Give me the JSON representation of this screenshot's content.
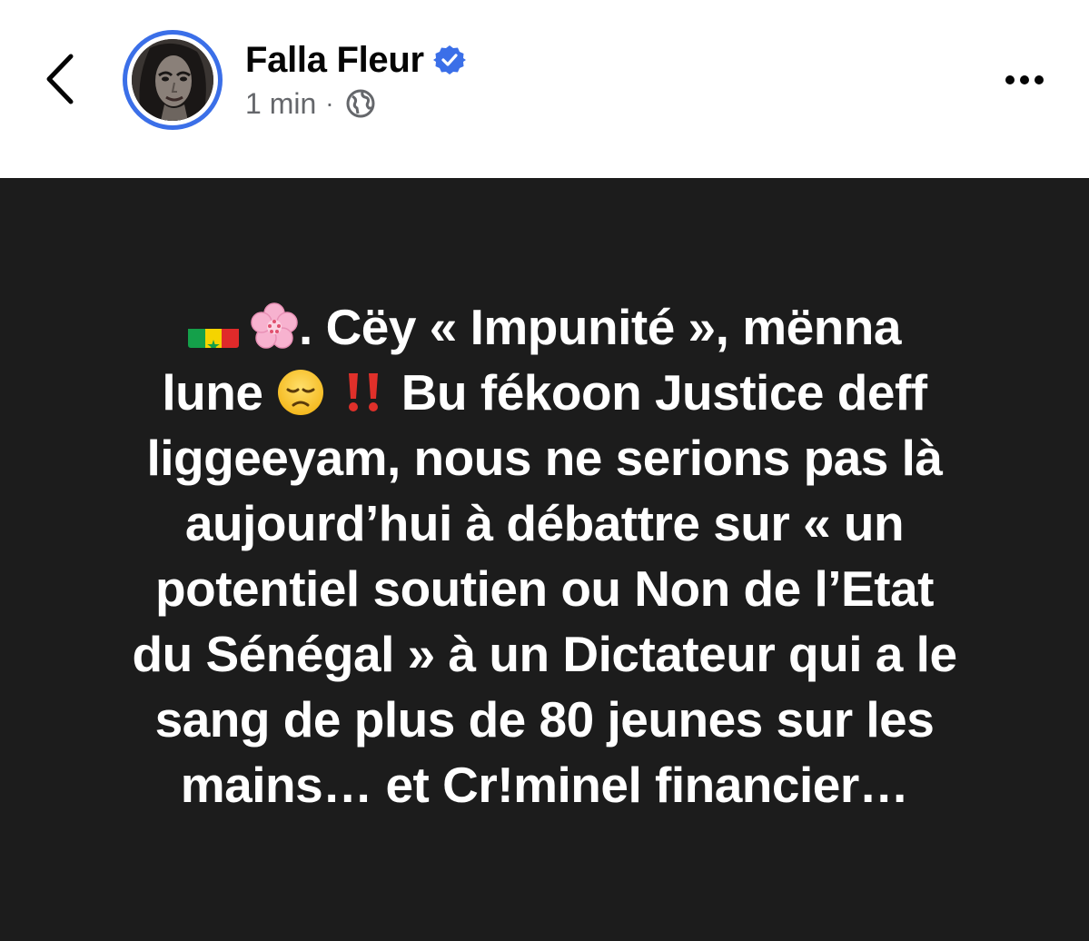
{
  "header": {
    "author_name": "Falla Fleur",
    "timestamp": "1 min",
    "separator": "·",
    "back_icon": "chevron-left-icon",
    "more_icon": "ellipsis-icon",
    "verified_icon": "verified-badge-icon",
    "privacy_icon": "globe-icon",
    "colors": {
      "name": "#050505",
      "meta": "#65676b",
      "verified": "#3b6fe8",
      "avatar_ring": "#3b6fe8"
    }
  },
  "post": {
    "background": "#1c1c1c",
    "text_color": "#ffffff",
    "emojis": [
      "senegal-flag-emoji",
      "cherry-blossom-emoji",
      "disappointed-face-emoji",
      "double-exclamation-emoji"
    ],
    "line1": ". Cëy « Impunité »,  mënna",
    "line2_a": "lune ",
    "line2_b": " Bu fékoon Justice deff",
    "line3": "liggeeyam, nous ne serions pas là",
    "line4": "aujourd’hui à débattre sur « un",
    "line5": "potentiel soutien ou Non de l’Etat",
    "line6": "du Sénégal » à un  Dictateur qui a le",
    "line7": "sang de plus de 80 jeunes sur les",
    "line8": "mains… et Cr!minel financier…"
  }
}
